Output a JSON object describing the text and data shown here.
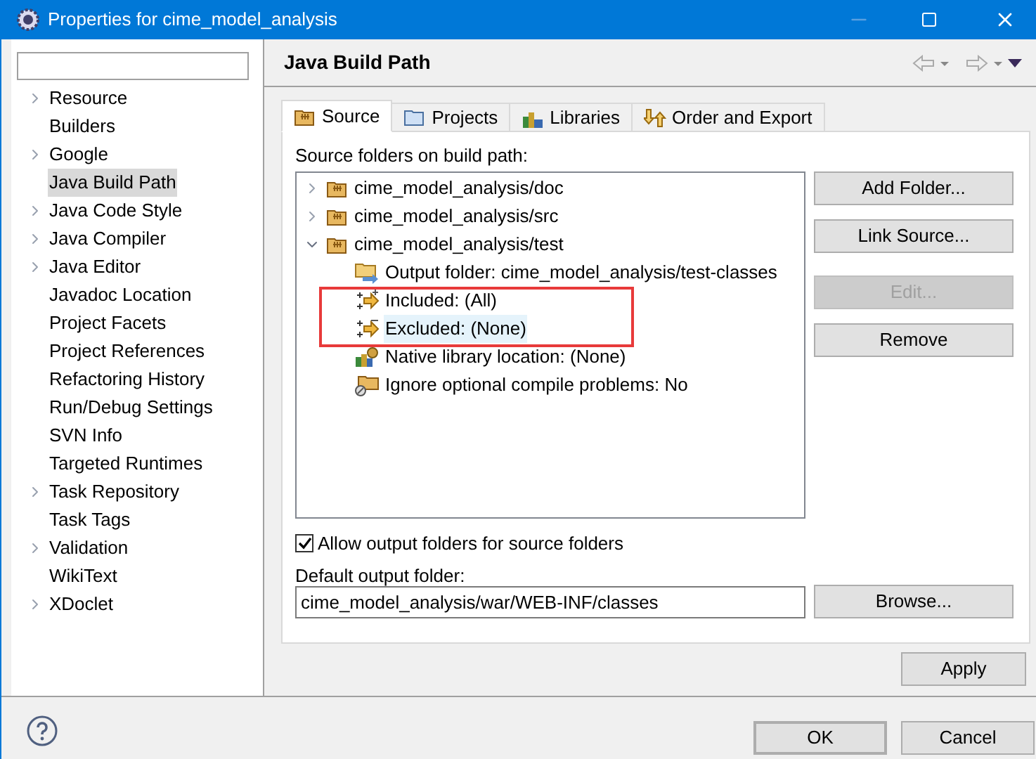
{
  "window": {
    "title": "Properties for cime_model_analysis"
  },
  "sidebar": {
    "items": [
      {
        "label": "Resource",
        "expandable": true,
        "selected": false
      },
      {
        "label": "Builders",
        "expandable": false,
        "selected": false
      },
      {
        "label": "Google",
        "expandable": true,
        "selected": false
      },
      {
        "label": "Java Build Path",
        "expandable": false,
        "selected": true
      },
      {
        "label": "Java Code Style",
        "expandable": true,
        "selected": false
      },
      {
        "label": "Java Compiler",
        "expandable": true,
        "selected": false
      },
      {
        "label": "Java Editor",
        "expandable": true,
        "selected": false
      },
      {
        "label": "Javadoc Location",
        "expandable": false,
        "selected": false
      },
      {
        "label": "Project Facets",
        "expandable": false,
        "selected": false
      },
      {
        "label": "Project References",
        "expandable": false,
        "selected": false
      },
      {
        "label": "Refactoring History",
        "expandable": false,
        "selected": false
      },
      {
        "label": "Run/Debug Settings",
        "expandable": false,
        "selected": false
      },
      {
        "label": "SVN Info",
        "expandable": false,
        "selected": false
      },
      {
        "label": "Targeted Runtimes",
        "expandable": false,
        "selected": false
      },
      {
        "label": "Task Repository",
        "expandable": true,
        "selected": false
      },
      {
        "label": "Task Tags",
        "expandable": false,
        "selected": false
      },
      {
        "label": "Validation",
        "expandable": true,
        "selected": false
      },
      {
        "label": "WikiText",
        "expandable": false,
        "selected": false
      },
      {
        "label": "XDoclet",
        "expandable": true,
        "selected": false
      }
    ]
  },
  "page": {
    "title": "Java Build Path",
    "tabs": [
      {
        "label": "Source",
        "selected": true,
        "kind": "source"
      },
      {
        "label": "Projects",
        "selected": false,
        "kind": "projects"
      },
      {
        "label": "Libraries",
        "selected": false,
        "kind": "libraries"
      },
      {
        "label": "Order and Export",
        "selected": false,
        "kind": "order"
      }
    ],
    "tree_label": "Source folders on build path:",
    "tree": [
      {
        "label": "cime_model_analysis/doc",
        "expanded": false,
        "selected": false
      },
      {
        "label": "cime_model_analysis/src",
        "expanded": false,
        "selected": false
      },
      {
        "label": "cime_model_analysis/test",
        "expanded": true,
        "selected": false,
        "children": [
          {
            "label": "Output folder: cime_model_analysis/test-classes",
            "selected": false,
            "kind": "output"
          },
          {
            "label": "Included: (All)",
            "selected": false,
            "kind": "included"
          },
          {
            "label": "Excluded: (None)",
            "selected": true,
            "kind": "excluded"
          },
          {
            "label": "Native library location: (None)",
            "selected": false,
            "kind": "native"
          },
          {
            "label": "Ignore optional compile problems: No",
            "selected": false,
            "kind": "ignore"
          }
        ]
      }
    ],
    "side_buttons": [
      {
        "label": "Add Folder...",
        "disabled": false
      },
      {
        "label": "Link Source...",
        "disabled": false
      },
      {
        "label": "Edit...",
        "disabled": true
      },
      {
        "label": "Remove",
        "disabled": false
      }
    ],
    "allow_output": {
      "label": "Allow output folders for source folders",
      "checked": true
    },
    "default_output": {
      "label": "Default output folder:",
      "value": "cime_model_analysis/war/WEB-INF/classes",
      "button": "Browse..."
    },
    "apply": "Apply"
  },
  "footer": {
    "buttons": [
      {
        "label": "OK",
        "default": true
      },
      {
        "label": "Cancel",
        "default": false
      }
    ]
  }
}
